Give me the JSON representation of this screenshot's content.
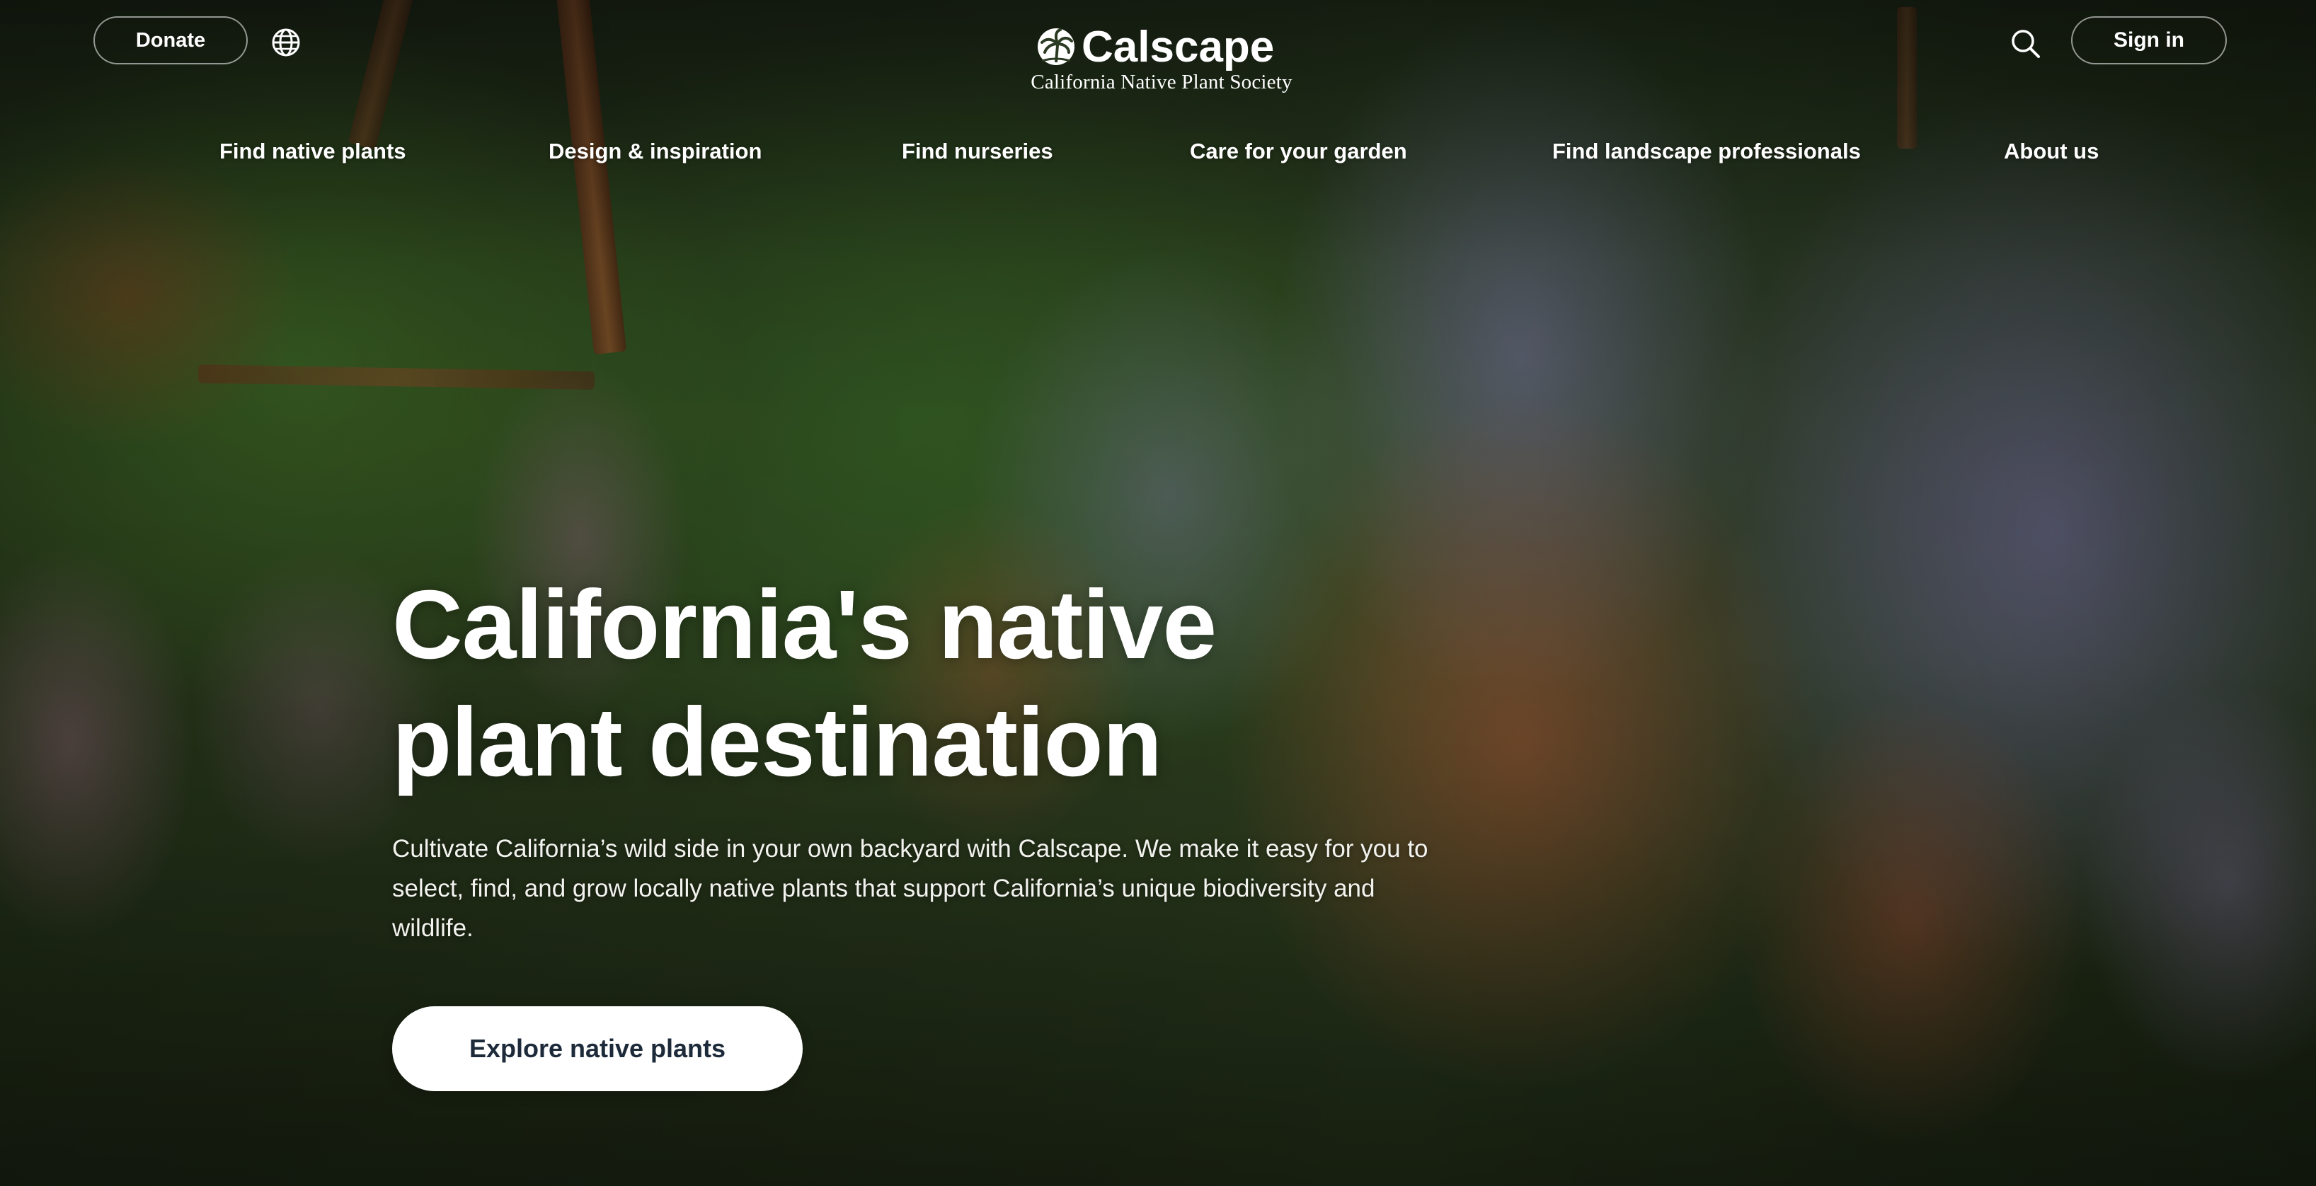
{
  "header": {
    "donate_label": "Donate",
    "language_icon": "globe-icon",
    "logo": {
      "wordmark": "Calscape",
      "subtitle": "California Native Plant Society",
      "icon": "palm-tree-logo-icon"
    },
    "search_icon": "search-icon",
    "signin_label": "Sign in"
  },
  "nav": {
    "items": [
      {
        "label": "Find native plants"
      },
      {
        "label": "Design & inspiration"
      },
      {
        "label": "Find nurseries"
      },
      {
        "label": "Care for your garden"
      },
      {
        "label": "Find landscape professionals"
      },
      {
        "label": "About us"
      }
    ]
  },
  "hero": {
    "title_line1": "California's native",
    "title_line2": "plant destination",
    "description": "Cultivate California’s wild side in your own backyard with Calscape. We make it easy for you to select, find, and grow locally native plants that support California’s unique biodiversity and wildlife.",
    "cta_label": "Explore native plants"
  },
  "colors": {
    "text": "#ffffff",
    "cta_background": "#ffffff",
    "cta_text": "#1d2a3a"
  }
}
